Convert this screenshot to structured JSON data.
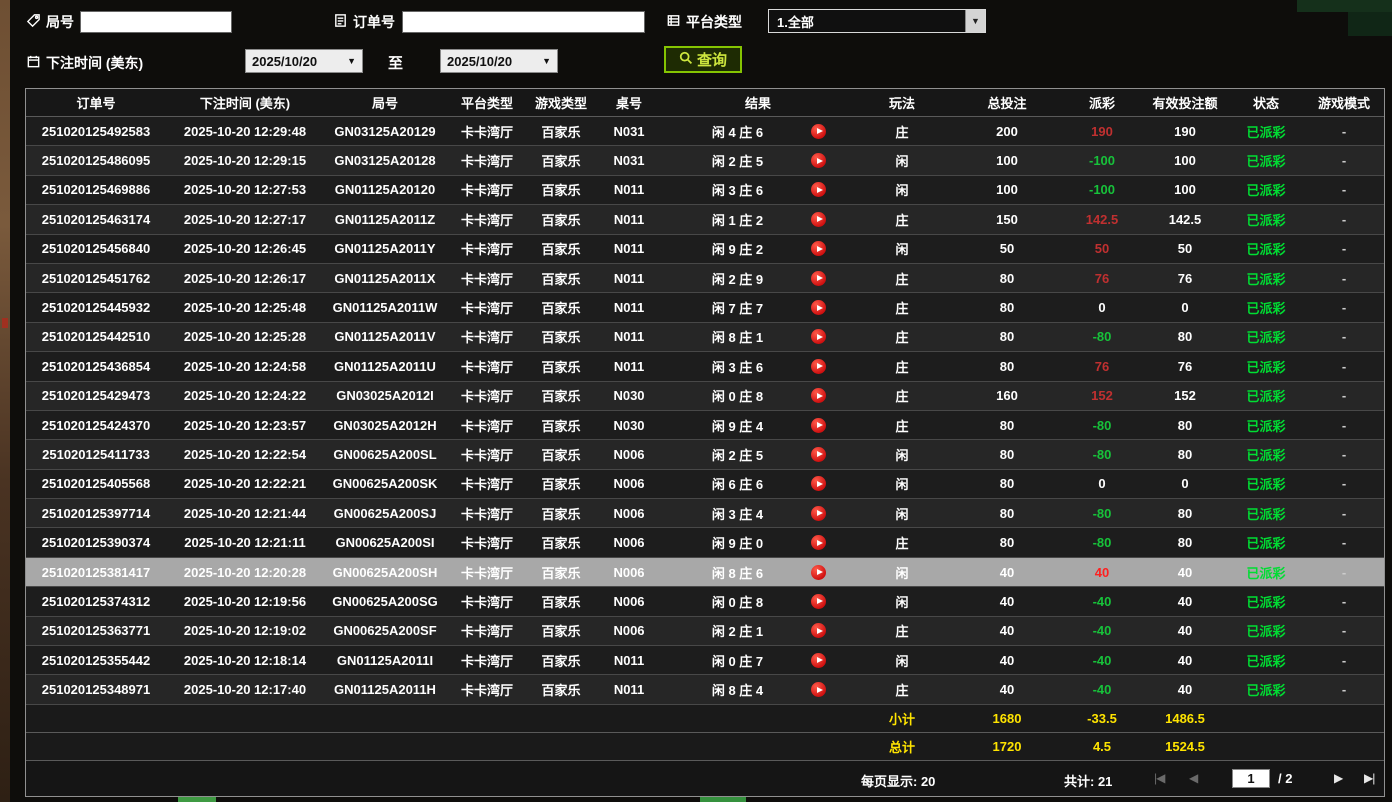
{
  "filters": {
    "round": {
      "label": "局号",
      "value": ""
    },
    "order": {
      "label": "订单号",
      "value": ""
    },
    "platform": {
      "label": "平台类型",
      "value": "1.全部"
    },
    "bet_time": {
      "label": "下注时间 (美东)",
      "from": "2025/10/20",
      "to": "2025/10/20",
      "to_label": "至"
    },
    "query_label": "查询"
  },
  "table": {
    "headers": [
      "订单号",
      "下注时间 (美东)",
      "局号",
      "平台类型",
      "游戏类型",
      "桌号",
      "结果",
      "玩法",
      "总投注",
      "派彩",
      "有效投注额",
      "状态",
      "游戏模式"
    ],
    "rows": [
      {
        "order": "251020125492583",
        "time": "2025-10-20 12:29:48",
        "round": "GN03125A20129",
        "platform": "卡卡湾厅",
        "game": "百家乐",
        "table": "N031",
        "result": "闲 4 庄 6",
        "play": "庄",
        "total": "200",
        "payout": "190",
        "payout_type": "pos",
        "valid": "190",
        "status": "已派彩",
        "mode": "-"
      },
      {
        "order": "251020125486095",
        "time": "2025-10-20 12:29:15",
        "round": "GN03125A20128",
        "platform": "卡卡湾厅",
        "game": "百家乐",
        "table": "N031",
        "result": "闲 2 庄 5",
        "play": "闲",
        "total": "100",
        "payout": "-100",
        "payout_type": "neg",
        "valid": "100",
        "status": "已派彩",
        "mode": "-"
      },
      {
        "order": "251020125469886",
        "time": "2025-10-20 12:27:53",
        "round": "GN01125A20120",
        "platform": "卡卡湾厅",
        "game": "百家乐",
        "table": "N011",
        "result": "闲 3 庄 6",
        "play": "闲",
        "total": "100",
        "payout": "-100",
        "payout_type": "neg",
        "valid": "100",
        "status": "已派彩",
        "mode": "-"
      },
      {
        "order": "251020125463174",
        "time": "2025-10-20 12:27:17",
        "round": "GN01125A2011Z",
        "platform": "卡卡湾厅",
        "game": "百家乐",
        "table": "N011",
        "result": "闲 1 庄 2",
        "play": "庄",
        "total": "150",
        "payout": "142.5",
        "payout_type": "pos",
        "valid": "142.5",
        "status": "已派彩",
        "mode": "-"
      },
      {
        "order": "251020125456840",
        "time": "2025-10-20 12:26:45",
        "round": "GN01125A2011Y",
        "platform": "卡卡湾厅",
        "game": "百家乐",
        "table": "N011",
        "result": "闲 9 庄 2",
        "play": "闲",
        "total": "50",
        "payout": "50",
        "payout_type": "pos",
        "valid": "50",
        "status": "已派彩",
        "mode": "-"
      },
      {
        "order": "251020125451762",
        "time": "2025-10-20 12:26:17",
        "round": "GN01125A2011X",
        "platform": "卡卡湾厅",
        "game": "百家乐",
        "table": "N011",
        "result": "闲 2 庄 9",
        "play": "庄",
        "total": "80",
        "payout": "76",
        "payout_type": "pos",
        "valid": "76",
        "status": "已派彩",
        "mode": "-"
      },
      {
        "order": "251020125445932",
        "time": "2025-10-20 12:25:48",
        "round": "GN01125A2011W",
        "platform": "卡卡湾厅",
        "game": "百家乐",
        "table": "N011",
        "result": "闲 7 庄 7",
        "play": "庄",
        "total": "80",
        "payout": "0",
        "payout_type": "zero",
        "valid": "0",
        "status": "已派彩",
        "mode": "-"
      },
      {
        "order": "251020125442510",
        "time": "2025-10-20 12:25:28",
        "round": "GN01125A2011V",
        "platform": "卡卡湾厅",
        "game": "百家乐",
        "table": "N011",
        "result": "闲 8 庄 1",
        "play": "庄",
        "total": "80",
        "payout": "-80",
        "payout_type": "neg",
        "valid": "80",
        "status": "已派彩",
        "mode": "-"
      },
      {
        "order": "251020125436854",
        "time": "2025-10-20 12:24:58",
        "round": "GN01125A2011U",
        "platform": "卡卡湾厅",
        "game": "百家乐",
        "table": "N011",
        "result": "闲 3 庄 6",
        "play": "庄",
        "total": "80",
        "payout": "76",
        "payout_type": "pos",
        "valid": "76",
        "status": "已派彩",
        "mode": "-"
      },
      {
        "order": "251020125429473",
        "time": "2025-10-20 12:24:22",
        "round": "GN03025A2012I",
        "platform": "卡卡湾厅",
        "game": "百家乐",
        "table": "N030",
        "result": "闲 0 庄 8",
        "play": "庄",
        "total": "160",
        "payout": "152",
        "payout_type": "pos",
        "valid": "152",
        "status": "已派彩",
        "mode": "-"
      },
      {
        "order": "251020125424370",
        "time": "2025-10-20 12:23:57",
        "round": "GN03025A2012H",
        "platform": "卡卡湾厅",
        "game": "百家乐",
        "table": "N030",
        "result": "闲 9 庄 4",
        "play": "庄",
        "total": "80",
        "payout": "-80",
        "payout_type": "neg",
        "valid": "80",
        "status": "已派彩",
        "mode": "-"
      },
      {
        "order": "251020125411733",
        "time": "2025-10-20 12:22:54",
        "round": "GN00625A200SL",
        "platform": "卡卡湾厅",
        "game": "百家乐",
        "table": "N006",
        "result": "闲 2 庄 5",
        "play": "闲",
        "total": "80",
        "payout": "-80",
        "payout_type": "neg",
        "valid": "80",
        "status": "已派彩",
        "mode": "-"
      },
      {
        "order": "251020125405568",
        "time": "2025-10-20 12:22:21",
        "round": "GN00625A200SK",
        "platform": "卡卡湾厅",
        "game": "百家乐",
        "table": "N006",
        "result": "闲 6 庄 6",
        "play": "闲",
        "total": "80",
        "payout": "0",
        "payout_type": "zero",
        "valid": "0",
        "status": "已派彩",
        "mode": "-"
      },
      {
        "order": "251020125397714",
        "time": "2025-10-20 12:21:44",
        "round": "GN00625A200SJ",
        "platform": "卡卡湾厅",
        "game": "百家乐",
        "table": "N006",
        "result": "闲 3 庄 4",
        "play": "闲",
        "total": "80",
        "payout": "-80",
        "payout_type": "neg",
        "valid": "80",
        "status": "已派彩",
        "mode": "-"
      },
      {
        "order": "251020125390374",
        "time": "2025-10-20 12:21:11",
        "round": "GN00625A200SI",
        "platform": "卡卡湾厅",
        "game": "百家乐",
        "table": "N006",
        "result": "闲 9 庄 0",
        "play": "庄",
        "total": "80",
        "payout": "-80",
        "payout_type": "neg",
        "valid": "80",
        "status": "已派彩",
        "mode": "-"
      },
      {
        "order": "251020125381417",
        "time": "2025-10-20 12:20:28",
        "round": "GN00625A200SH",
        "platform": "卡卡湾厅",
        "game": "百家乐",
        "table": "N006",
        "result": "闲 8 庄 6",
        "play": "闲",
        "total": "40",
        "payout": "40",
        "payout_type": "pos",
        "valid": "40",
        "status": "已派彩",
        "mode": "-",
        "selected": true
      },
      {
        "order": "251020125374312",
        "time": "2025-10-20 12:19:56",
        "round": "GN00625A200SG",
        "platform": "卡卡湾厅",
        "game": "百家乐",
        "table": "N006",
        "result": "闲 0 庄 8",
        "play": "闲",
        "total": "40",
        "payout": "-40",
        "payout_type": "neg",
        "valid": "40",
        "status": "已派彩",
        "mode": "-"
      },
      {
        "order": "251020125363771",
        "time": "2025-10-20 12:19:02",
        "round": "GN00625A200SF",
        "platform": "卡卡湾厅",
        "game": "百家乐",
        "table": "N006",
        "result": "闲 2 庄 1",
        "play": "庄",
        "total": "40",
        "payout": "-40",
        "payout_type": "neg",
        "valid": "40",
        "status": "已派彩",
        "mode": "-"
      },
      {
        "order": "251020125355442",
        "time": "2025-10-20 12:18:14",
        "round": "GN01125A2011I",
        "platform": "卡卡湾厅",
        "game": "百家乐",
        "table": "N011",
        "result": "闲 0 庄 7",
        "play": "闲",
        "total": "40",
        "payout": "-40",
        "payout_type": "neg",
        "valid": "40",
        "status": "已派彩",
        "mode": "-"
      },
      {
        "order": "251020125348971",
        "time": "2025-10-20 12:17:40",
        "round": "GN01125A2011H",
        "platform": "卡卡湾厅",
        "game": "百家乐",
        "table": "N011",
        "result": "闲 8 庄 4",
        "play": "庄",
        "total": "40",
        "payout": "-40",
        "payout_type": "neg",
        "valid": "40",
        "status": "已派彩",
        "mode": "-"
      }
    ],
    "subtotal": {
      "label": "小计",
      "total_bet": "1680",
      "payout": "-33.5",
      "valid_bet": "1486.5"
    },
    "grand_total": {
      "label": "总计",
      "total_bet": "1720",
      "payout": "4.5",
      "valid_bet": "1524.5"
    }
  },
  "pagination": {
    "per_page": "每页显示: 20",
    "total_count": "共计: 21",
    "page": "1",
    "page_total": "/ 2",
    "first_glyph": "|◀",
    "prev_glyph": "◀",
    "next_glyph": "▶",
    "last_glyph": "▶|"
  },
  "colors": {
    "win_payout": "#c03030",
    "loss_payout": "#17c23a",
    "status_paid": "#00dd33",
    "totals_yellow": "#ffe400",
    "query_green": "#85c402",
    "selected_row": "#a8a8a8"
  }
}
